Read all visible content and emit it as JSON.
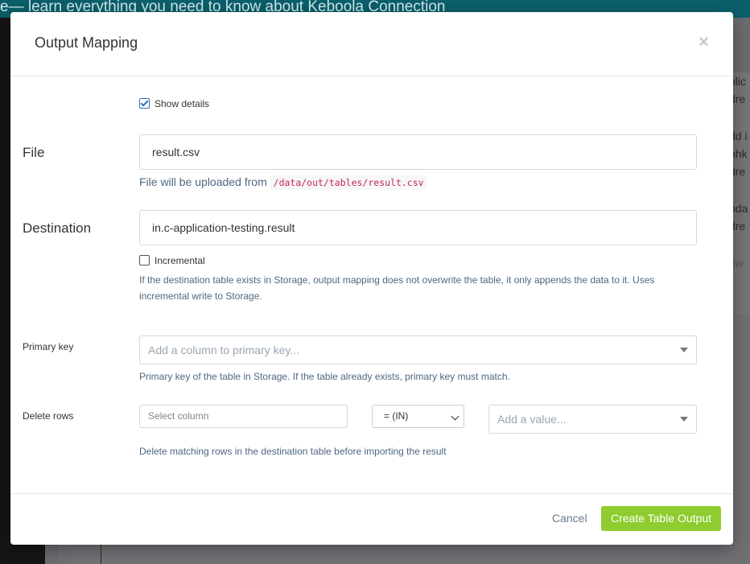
{
  "background": {
    "banner_text": "e— learn everything you need to know about Keboola Connection",
    "panel_lines": [
      "plic",
      "dre",
      "",
      "dd i",
      "nhk",
      "dre",
      "",
      "pda",
      "dre",
      "",
      "ow"
    ]
  },
  "modal": {
    "title": "Output Mapping",
    "close_glyph": "×",
    "show_details_label": "Show details",
    "file": {
      "label": "File",
      "value": "result.csv",
      "help_prefix": "File will be uploaded from",
      "help_path": "/data/out/tables/result.csv"
    },
    "destination": {
      "label": "Destination",
      "value": "in.c-application-testing.result",
      "incremental_label": "Incremental",
      "help_line1": "If the destination table exists in Storage, output mapping does not overwrite the table, it only appends the data to it. Uses",
      "help_line2": "incremental write to Storage."
    },
    "primary_key": {
      "label": "Primary key",
      "placeholder": "Add a column to primary key...",
      "help": "Primary key of the table in Storage. If the table already exists, primary key must match."
    },
    "delete_rows": {
      "label": "Delete rows",
      "column_placeholder": "Select column",
      "operator": "= (IN)",
      "value_placeholder": "Add a value...",
      "help": "Delete matching rows in the destination table before importing the result"
    },
    "footer": {
      "cancel_label": "Cancel",
      "create_label": "Create Table Output"
    }
  },
  "colors": {
    "accent_green": "#8ecc2f",
    "help_text": "#4f6781",
    "code_text": "#c7254e",
    "banner": "#0b5f6a"
  }
}
